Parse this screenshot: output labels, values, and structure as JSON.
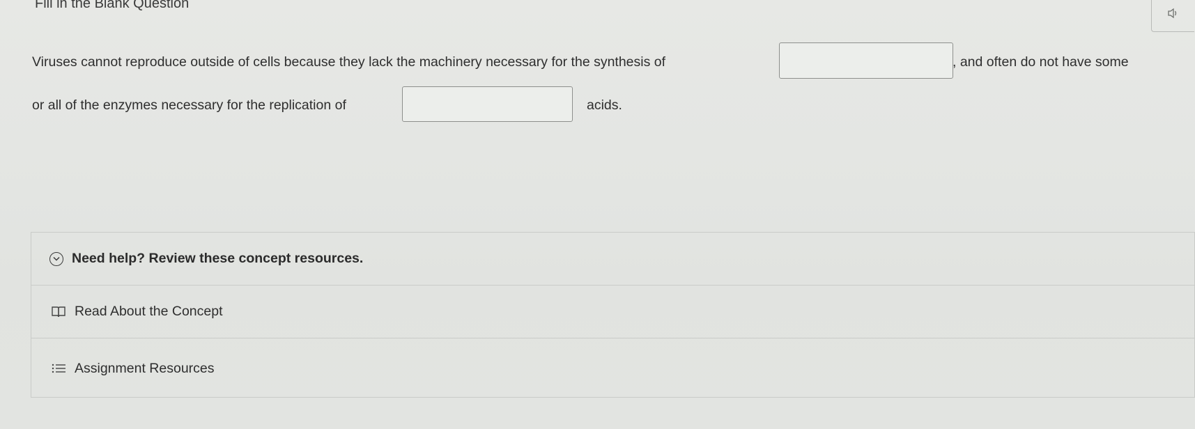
{
  "header": {
    "title": "Fill in the Blank Question",
    "audio_icon": "speaker-icon"
  },
  "question": {
    "line1_before": "Viruses cannot reproduce outside of cells because they lack the machinery necessary for the synthesis of",
    "blank1_value": "",
    "line1_after": ", and often do not have some",
    "line2_before": "or all of the enzymes necessary for the replication of",
    "blank2_value": "",
    "line2_after": "acids."
  },
  "help": {
    "title": "Need help? Review these concept resources.",
    "toggle_icon": "chevron-down-circle-icon",
    "resources": [
      {
        "label": "Read About the Concept",
        "icon": "book-icon"
      },
      {
        "label": "Assignment Resources",
        "icon": "list-icon"
      }
    ]
  }
}
